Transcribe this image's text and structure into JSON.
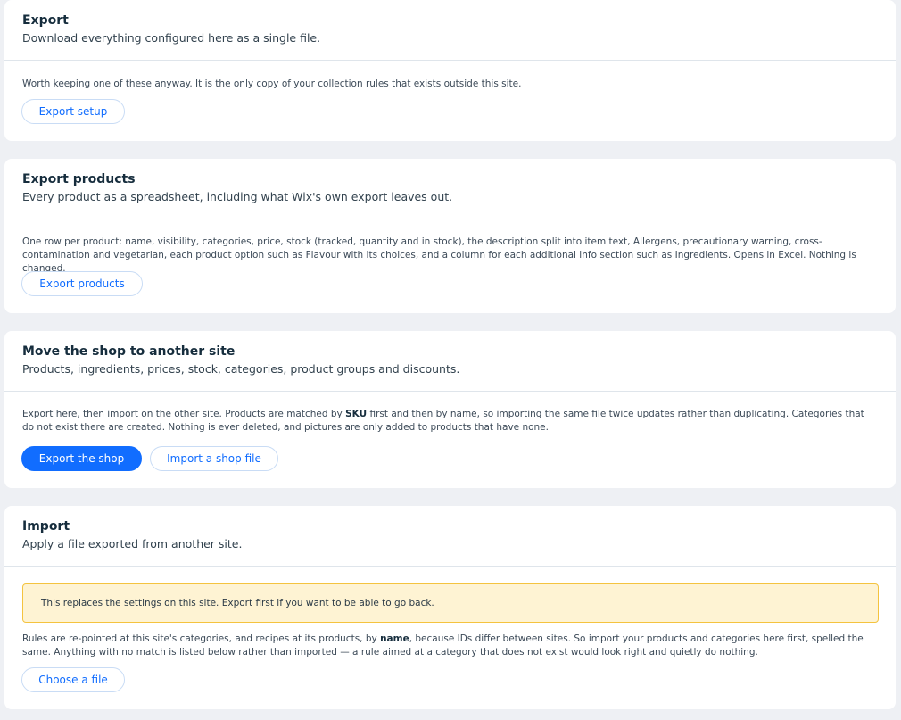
{
  "export_setup": {
    "title": "Export",
    "subtitle": "Download everything configured here as a single file.",
    "body": "Worth keeping one of these anyway. It is the only copy of your collection rules that exists outside this site.",
    "button_label": "Export setup"
  },
  "export_products": {
    "title": "Export products",
    "subtitle": "Every product as a spreadsheet, including what Wix's own export leaves out.",
    "body": "One row per product: name, visibility, categories, price, stock (tracked, quantity and in stock), the description split into item text, Allergens, precautionary warning, cross-contamination and vegetarian, each product option such as Flavour with its choices, and a column for each additional info section such as Ingredients. Opens in Excel. Nothing is changed.",
    "button_label": "Export products"
  },
  "move_shop": {
    "title": "Move the shop to another site",
    "subtitle": "Products, ingredients, prices, stock, categories, product groups and discounts.",
    "body_before": "Export here, then import on the other site. Products are matched by ",
    "body_bold": "SKU",
    "body_after": " first and then by name, so importing the same file twice updates rather than duplicating. Categories that do not exist there are created. Nothing is ever deleted, and pictures are only added to products that have none.",
    "primary_button_label": "Export the shop",
    "secondary_button_label": "Import a shop file"
  },
  "import": {
    "title": "Import",
    "subtitle": "Apply a file exported from another site.",
    "notice": "This replaces the settings on this site. Export first if you want to be able to go back.",
    "body_before": "Rules are re-pointed at this site's categories, and recipes at its products, by ",
    "body_bold": "name",
    "body_after": ", because IDs differ between sites. So import your products and categories here first, spelled the same. Anything with no match is listed below rather than imported — a rule aimed at a category that does not exist would look right and quietly do nothing.",
    "button_label": "Choose a file"
  },
  "colors": {
    "accent": "#116dff",
    "notice_background": "#fef3d3",
    "notice_border": "#f4c33f",
    "page_background": "#eef0f4"
  }
}
